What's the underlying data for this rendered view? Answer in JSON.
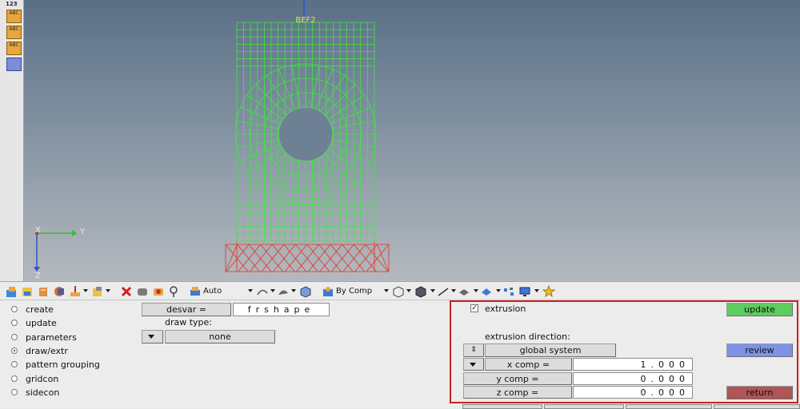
{
  "viewport": {
    "model_label": "BEF2",
    "axis_y": "Y",
    "axis_x": "X",
    "axis_z": "Z",
    "side_buttons": [
      "123",
      "ABC",
      "ABC",
      "ABC",
      ""
    ]
  },
  "toolbar": {
    "display_mode": "Auto",
    "color_mode": "By Comp"
  },
  "panel": {
    "radios": [
      {
        "label": "create",
        "selected": false
      },
      {
        "label": "update",
        "selected": false
      },
      {
        "label": "parameters",
        "selected": false
      },
      {
        "label": "draw/extr",
        "selected": true
      },
      {
        "label": "pattern grouping",
        "selected": false
      },
      {
        "label": "gridcon",
        "selected": false
      },
      {
        "label": "sidecon",
        "selected": false
      }
    ],
    "desvar_label": "desvar =",
    "desvar_value": "frshape",
    "draw_type_label": "draw type:",
    "draw_type_value": "none",
    "extrusion_label": "extrusion",
    "extrusion_checked": true,
    "extrusion_direction_label": "extrusion direction:",
    "system_value": "global system",
    "x_comp_label": "x comp =",
    "x_comp_value": "1.000",
    "y_comp_label": "y comp  =",
    "y_comp_value": "0.000",
    "z_comp_label": "z comp  =",
    "z_comp_value": "0.000",
    "update_label": "update",
    "review_label": "review",
    "return_label": "return"
  },
  "colors": {
    "mesh": "#3ee83e",
    "base": "#e8301e",
    "update_btn": "#5fcc5f",
    "review_btn": "#7d93e8",
    "return_btn": "#b05555",
    "highlight_box": "#cc2028"
  }
}
